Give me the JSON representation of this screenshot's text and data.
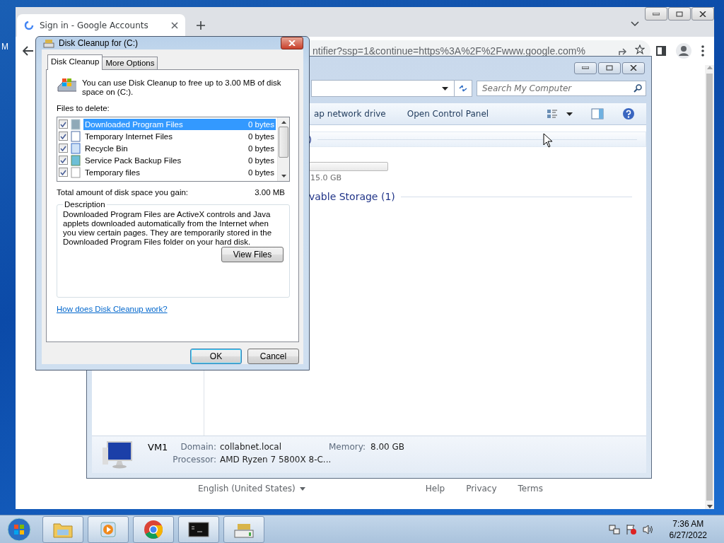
{
  "desktop": {
    "label": "M"
  },
  "browser": {
    "tab": {
      "title": "Sign in - Google Accounts",
      "selected": true
    },
    "url": "ntifier?ssp=1&continue=https%3A%2F%2Fwww.google.com%",
    "footer": {
      "language": "English (United States)",
      "links": [
        "Help",
        "Privacy",
        "Terms"
      ]
    }
  },
  "explorer": {
    "search": {
      "placeholder": "Search My Computer"
    },
    "toolbar": [
      "ap network drive",
      "Open Control Panel"
    ],
    "group_header": ")",
    "drive_size": "15.0 GB",
    "section": "vable Storage (1)",
    "details": {
      "name": "VM1",
      "fields": [
        {
          "label": "Domain:",
          "value": "collabnet.local"
        },
        {
          "label": "Memory:",
          "value": "8.00 GB"
        },
        {
          "label": "Processor:",
          "value": "AMD Ryzen 7 5800X 8-C..."
        }
      ]
    }
  },
  "dialog": {
    "title": "Disk Cleanup for  (C:)",
    "tabs": [
      {
        "label": "Disk Cleanup",
        "selected": true
      },
      {
        "label": "More Options",
        "selected": false
      }
    ],
    "intro": "You can use Disk Cleanup to free up to 3.00 MB of disk space on  (C:).",
    "files_label": "Files to delete:",
    "files": [
      {
        "name": "Downloaded Program Files",
        "size": "0 bytes",
        "checked": true,
        "selected": true
      },
      {
        "name": "Temporary Internet Files",
        "size": "0 bytes",
        "checked": true,
        "selected": false
      },
      {
        "name": "Recycle Bin",
        "size": "0 bytes",
        "checked": true,
        "selected": false
      },
      {
        "name": "Service Pack Backup Files",
        "size": "0 bytes",
        "checked": true,
        "selected": false
      },
      {
        "name": "Temporary files",
        "size": "0 bytes",
        "checked": true,
        "selected": false
      }
    ],
    "total_label": "Total amount of disk space you gain:",
    "total_value": "3.00 MB",
    "description_title": "Description",
    "description": "Downloaded Program Files are ActiveX controls and Java applets downloaded automatically from the Internet when you view certain pages. They are temporarily stored in the Downloaded Program Files folder on your hard disk.",
    "view_files": "View Files",
    "help_link": "How does Disk Cleanup work?",
    "buttons": [
      {
        "label": "OK",
        "default": true
      },
      {
        "label": "Cancel",
        "default": false
      }
    ]
  },
  "taskbar": {
    "time": "7:36 AM",
    "date": "6/27/2022"
  }
}
